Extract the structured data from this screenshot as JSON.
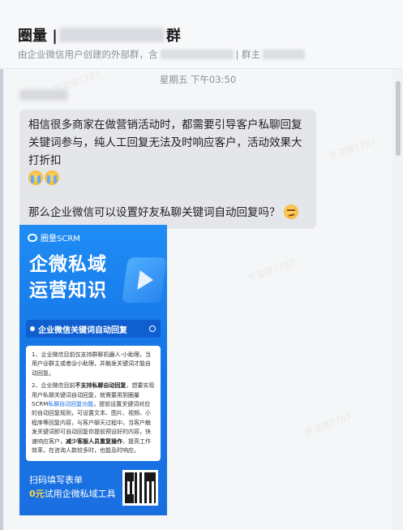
{
  "header": {
    "title_prefix": "圈量 |",
    "title_suffix": "群",
    "subtitle_left": "由企业微信用户创建的外部群，含",
    "subtitle_right": "| 群主"
  },
  "chat": {
    "timestamp": "星期五 下午03:50",
    "message": {
      "line1": "相信很多商家在做营销活动时，都需要引导客户私聊回复关键词参与，纯人工回复无法及时响应客户，活动效果大打折扣",
      "line2": "那么企业微信可以设置好友私聊关键词自动回复吗？"
    }
  },
  "poster": {
    "logo_text": "圈量SCRM",
    "title_line1": "企微私域",
    "title_line2": "运营知识",
    "ribbon": "企业微信关键词自动回复",
    "p1": "1、企业微信目前仅支持群聊机器人-小助理，当用户@群主或者@小助理，并触发关键词才能自动回复。",
    "p2a": "2、企业微信目前",
    "p2b": "不支持私聊自动回复",
    "p2c": "，想要实现用户私聊关键词自动回复，就需要用到圈量SCRM",
    "p2d": "私聊自动回复功能",
    "p2e": "，提前设置关键词对应的自动回复规则，可设置文本、图片、视频、小程序等回复内容，与客户聊天过程中，当客户触发关键词即可自动回复你提前预设好的内容，快速响应客户，",
    "p2f": "减少客服人员重复操作",
    "p2g": "，提高工作效率，在咨询人数较多时，也能及时响应。",
    "cta_line1": "扫码填写表单",
    "cta_amount": "0元",
    "cta_line2": "试用企微私域工具"
  },
  "watermark": "罗滢娜7787"
}
